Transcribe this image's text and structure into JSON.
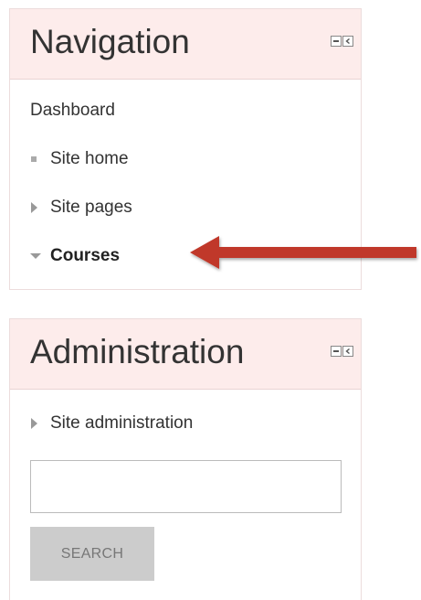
{
  "navigation_block": {
    "title": "Navigation",
    "items": [
      {
        "label": "Dashboard",
        "marker": "none"
      },
      {
        "label": "Site home",
        "marker": "square"
      },
      {
        "label": "Site pages",
        "marker": "collapsed-arrow"
      },
      {
        "label": "Courses",
        "marker": "expanded-arrow"
      }
    ]
  },
  "administration_block": {
    "title": "Administration",
    "items": [
      {
        "label": "Site administration",
        "marker": "collapsed-arrow"
      }
    ],
    "search": {
      "value": "",
      "button_label": "SEARCH"
    }
  },
  "block_controls": {
    "icons": [
      "hide-block-icon",
      "dock-block-icon"
    ]
  },
  "annotation": {
    "icon": "red-arrow-icon",
    "color": "#c0392b"
  },
  "colors": {
    "header_bg": "#fdeceb",
    "border": "#ecdcdc",
    "button_bg": "#cccccc",
    "arrow": "#c0392b"
  }
}
